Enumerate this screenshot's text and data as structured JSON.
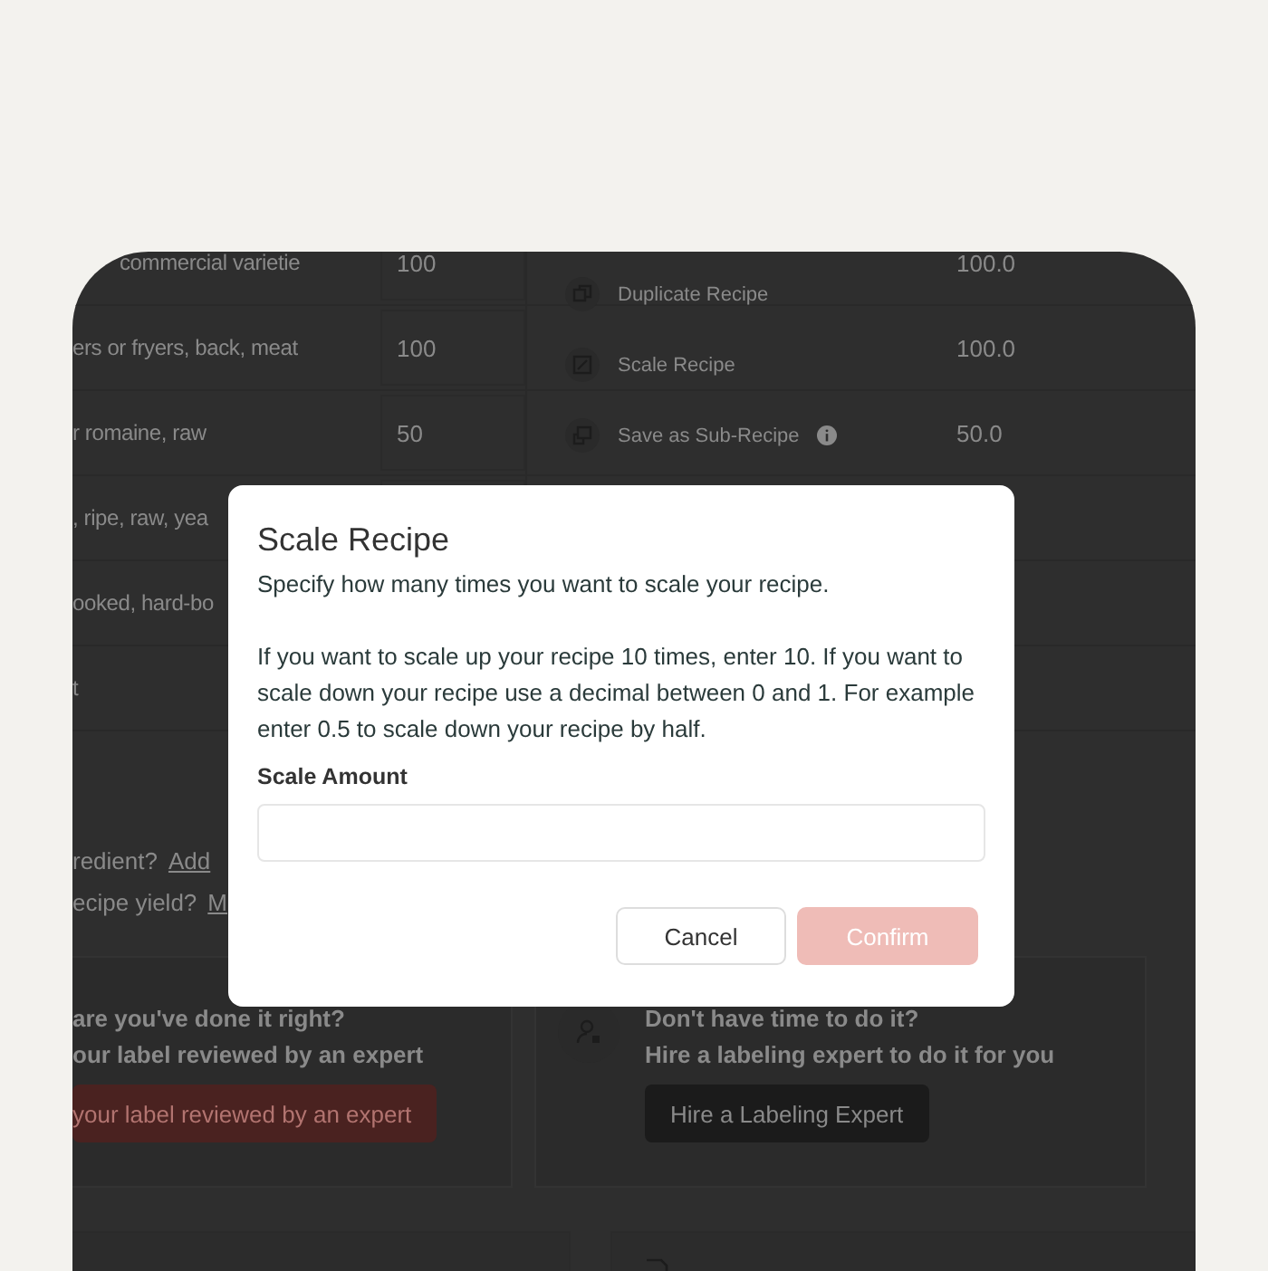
{
  "ingredients": [
    {
      "name": "commercial varietie",
      "amount": "100",
      "value": "100.0"
    },
    {
      "name": "ers or fryers, back, meat",
      "amount": "100",
      "value": "100.0"
    },
    {
      "name": "r romaine, raw",
      "amount": "50",
      "value": "50.0"
    },
    {
      "name": ", ripe, raw, yea"
    },
    {
      "name": "ooked, hard-bo"
    },
    {
      "name": "t"
    }
  ],
  "menu": [
    {
      "kind": "duplicate",
      "label": "Duplicate Recipe",
      "info": false
    },
    {
      "kind": "scale",
      "label": "Scale Recipe",
      "info": false
    },
    {
      "kind": "subrecipe",
      "label": "Save as Sub-Recipe",
      "info": true
    }
  ],
  "links": [
    {
      "text": "redient?",
      "link": "Add"
    },
    {
      "text": "ecipe yield?",
      "link": "M"
    }
  ],
  "cards": [
    {
      "kind": "review",
      "title": "are you've done it right?",
      "subtitle": "our label reviewed by an expert",
      "button": "your label reviewed by an expert"
    },
    {
      "kind": "hire",
      "title": "Don't have time to do it?",
      "subtitle": "Hire a labeling expert to do it for you",
      "button": "Hire a Labeling Expert"
    }
  ],
  "dialog": {
    "title": "Scale Recipe",
    "intro": "Specify how many times you want to scale your recipe.",
    "help": "If you want to scale up your recipe 10 times, enter 10. If you want to scale down your recipe use a decimal between 0 and 1. For example enter 0.5 to scale down your recipe by half.",
    "field_label": "Scale Amount",
    "cancel": "Cancel",
    "confirm": "Confirm",
    "confirm_disabled": true
  }
}
